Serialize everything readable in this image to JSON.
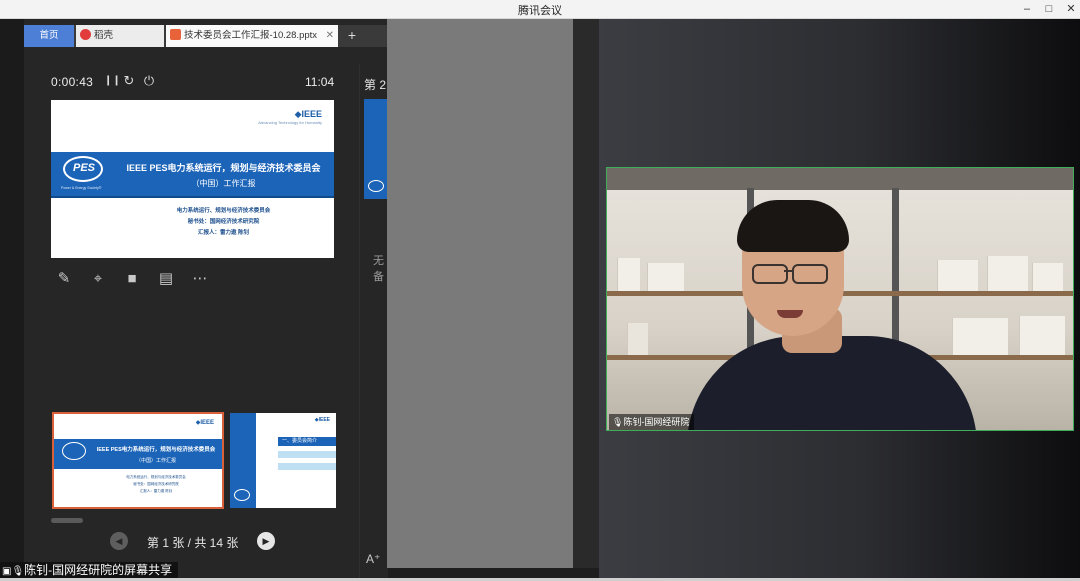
{
  "window": {
    "title": "腾讯会议",
    "minimize": "–",
    "maximize": "□",
    "close": "✕"
  },
  "tabs": [
    {
      "label": "首页"
    },
    {
      "label": "稻壳"
    },
    {
      "label": "技术委员会工作汇报-10.28.pptx"
    }
  ],
  "tab_new": "+",
  "presenter": {
    "elapsed": "0:00:43",
    "clock": "11:04",
    "pause_icon": "❙❙",
    "restart_icon": "↻",
    "power_icon": "⏻"
  },
  "slide": {
    "logo": "◆IEEE",
    "logo_sub": "Advancing Technology for Humanity",
    "pes": "PES",
    "pes_tagline": "Power & Energy Society®",
    "title_line1": "IEEE PES电力系统运行，规划与经济技术委员会",
    "title_line2": "（中国）工作汇报",
    "sub1": "电力系统运行、规划与经济技术委员会",
    "sub2": "秘书处：国网经济技术研究院",
    "sub3": "汇报人：雷力遨  陈钊"
  },
  "tools": [
    "pen-icon",
    "laser-icon",
    "camera-icon",
    "comment-icon",
    "more-icon"
  ],
  "tool_glyphs": [
    "✎",
    "⌖",
    "■",
    "▤",
    "⋯"
  ],
  "thumb2": {
    "heading": "一、委员会简介"
  },
  "pager": {
    "text": "第 1 张 / 共 14 张",
    "prev": "◀",
    "next": "▶"
  },
  "right_strip": {
    "label": "第 2",
    "note": "无备",
    "font_icon": "A⁺"
  },
  "video": {
    "name": "陈钊-国网经研院",
    "mic": "🎙"
  },
  "share_label": "陈钊-国网经研院的屏幕共享",
  "colors": {
    "accent": "#4d7fd6",
    "slide_blue": "#1c64b8",
    "thumb_border": "#d8603a",
    "video_border": "#3fae5a"
  }
}
